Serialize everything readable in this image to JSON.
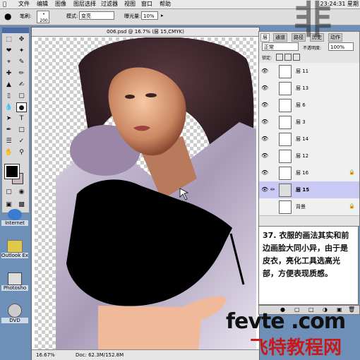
{
  "menubar": {
    "items": [
      "文件",
      "编辑",
      "图像",
      "图层",
      "选择",
      "过滤器",
      "视图",
      "窗口",
      "帮助"
    ],
    "clock": "23:24:31 星期"
  },
  "options": {
    "brush_label": "笔刷:",
    "brush_size": "200",
    "mode_label": "模式:",
    "mode_value": "变亮",
    "opacity_label": "曝光量:",
    "opacity_value": "10%"
  },
  "document": {
    "title": "006.psd @ 16.7% (层 15,CMYK)",
    "zoom": "16.67%",
    "doc_size": "Doc: 62.3M/152.8M"
  },
  "desktop": {
    "icons": [
      {
        "label": "Internet",
        "icon": "globe-icon"
      },
      {
        "label": "Outlook Ex",
        "icon": "mail-icon"
      },
      {
        "label": "Photosho",
        "icon": "photoshop-icon"
      },
      {
        "label": "DVD",
        "icon": "dvd-icon"
      }
    ]
  },
  "layers_panel": {
    "tabs": [
      "层",
      "通道",
      "路径",
      "历史",
      "动作"
    ],
    "blend_mode": "正常",
    "opacity": "100%",
    "fill_label": "不透明度:",
    "lock_label": "锁定:",
    "layers": [
      {
        "name": "层 11",
        "visible": true,
        "selected": false,
        "locked": false
      },
      {
        "name": "层 13",
        "visible": true,
        "selected": false,
        "locked": false
      },
      {
        "name": "层 6",
        "visible": true,
        "selected": false,
        "locked": false
      },
      {
        "name": "层 3",
        "visible": true,
        "selected": false,
        "locked": false
      },
      {
        "name": "层 14",
        "visible": true,
        "selected": false,
        "locked": false
      },
      {
        "name": "层 12",
        "visible": true,
        "selected": false,
        "locked": false
      },
      {
        "name": "层 16",
        "visible": true,
        "selected": false,
        "locked": true
      },
      {
        "name": "层 15",
        "visible": true,
        "selected": true,
        "locked": false
      },
      {
        "name": "背景",
        "visible": false,
        "selected": false,
        "locked": true
      }
    ]
  },
  "caption": {
    "text": "37. 衣服的画法其实和前边画脸大同小异，由于是皮衣，亮化工具选高光部，方便表现质感。"
  },
  "watermark": {
    "site": "fevte .com",
    "cn": "飞特教程网",
    "side_glyph": "非"
  },
  "colors": {
    "foreground": "#000000",
    "background": "#ffffff",
    "selection": "#c9c9f4",
    "watermark_red": "#c81818"
  }
}
